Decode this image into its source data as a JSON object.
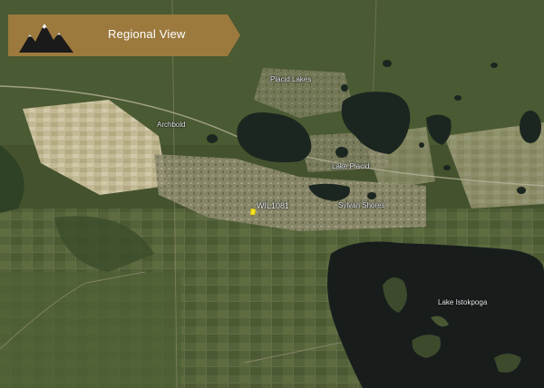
{
  "banner": {
    "title": "Regional View",
    "logo_icon": "mountain-logo-icon",
    "bg_color": "#9c7a3e"
  },
  "places": {
    "placid_lakes": "Placid Lakes",
    "archbold": "Archbold",
    "lake_placid": "Lake Placid",
    "sylvan_shores": "Sylvan Shores",
    "lake_istokpoga": "Lake Istokpoga"
  },
  "site": {
    "label": "WIL1081",
    "marker_color": "#f2e21a",
    "marker_icon": "site-marker-icon"
  }
}
